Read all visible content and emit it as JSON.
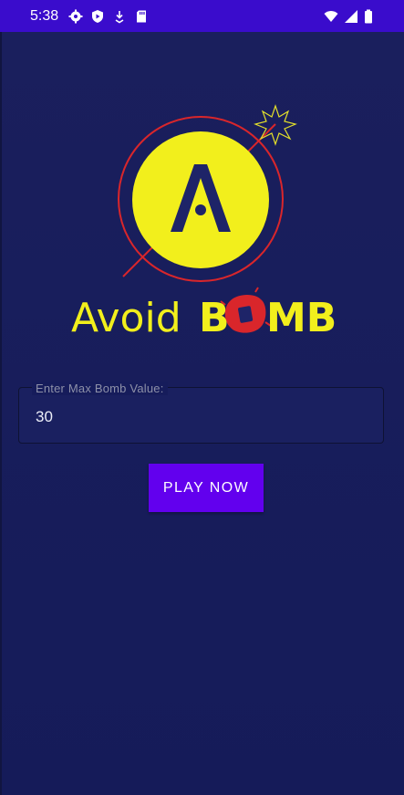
{
  "status_bar": {
    "time": "5:38",
    "left_icons": [
      "settings-icon",
      "play-protect-icon",
      "download-icon",
      "sd-card-icon"
    ],
    "right_icons": [
      "wifi-icon",
      "cell-signal-icon",
      "battery-icon"
    ],
    "color": "#3a0ccc"
  },
  "logo": {
    "text_part1": "Avoid",
    "text_part2": "B",
    "text_part3": "MB",
    "circle_letter": "A",
    "colors": {
      "yellow": "#f2ef1c",
      "red": "#d9262b",
      "navy": "#1e2468"
    }
  },
  "form": {
    "max_bomb_label": "Enter Max Bomb Value:",
    "max_bomb_value": "30"
  },
  "actions": {
    "play_label": "PLAY NOW",
    "play_color": "#6200ee"
  },
  "theme": {
    "background": "#161c5b"
  }
}
